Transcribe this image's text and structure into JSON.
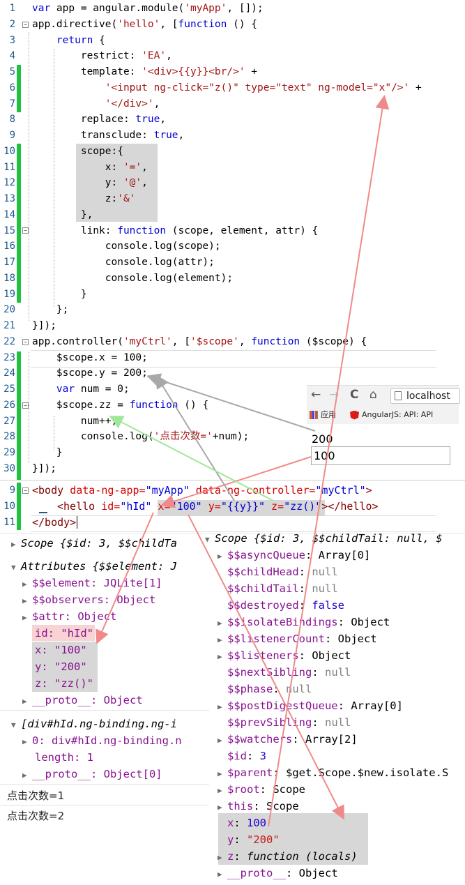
{
  "js_code": {
    "line_numbers": [
      "1",
      "2",
      "3",
      "4",
      "5",
      "6",
      "7",
      "8",
      "9",
      "10",
      "11",
      "12",
      "13",
      "14",
      "15",
      "16",
      "17",
      "18",
      "19",
      "20",
      "21",
      "22",
      "23",
      "24",
      "25",
      "26",
      "27",
      "28",
      "29",
      "30"
    ],
    "lines": [
      "var app = angular.module('myApp', []);",
      "app.directive('hello', [function () {",
      "    return {",
      "        restrict: 'EA',",
      "        template: '<div>{{y}}<br/>' +",
      "            '<input ng-click=\"z()\" type=\"text\" ng-model=\"x\"/>' +",
      "            '</div>',",
      "        replace: true,",
      "        transclude: true,",
      "        scope:{",
      "            x: '=',",
      "            y: '@',",
      "            z:'&'",
      "        },",
      "        link: function (scope, element, attr) {",
      "            console.log(scope);",
      "            console.log(attr);",
      "            console.log(element);",
      "        }",
      "    };",
      "}]);",
      "app.controller('myCtrl', ['$scope', function ($scope) {",
      "    $scope.x = 100;",
      "    $scope.y = 200;",
      "    var num = 0;",
      "    $scope.zz = function () {",
      "        num++;",
      "        console.log('点击次数='+num);",
      "    }",
      "}]);"
    ]
  },
  "html_code": {
    "line_numbers": [
      "9",
      "10",
      "11"
    ],
    "line9_parts": [
      "<body ",
      "data-ng-app=",
      "\"myApp\"",
      " data-ng-controller=",
      "\"myCtrl\"",
      ">"
    ],
    "line10_parts": [
      "<hello ",
      "id=",
      "\"hId\"",
      " x=",
      "\"100\"",
      " y=",
      "\"{{y}}\"",
      " z=",
      "\"zz()\"",
      "></hello>"
    ],
    "line11": "</body>"
  },
  "browser": {
    "back_icon": "←",
    "forward_icon": "→",
    "reload_icon": "C",
    "home_icon": "⌂",
    "url": "localhost",
    "bookmarks": [
      "应用",
      "AngularJS: API: API"
    ],
    "output_text": "200",
    "input_value": "100"
  },
  "console_left": {
    "scope_row": "Scope {$id: 3, $$childTa",
    "attributes_row": "Attributes {$$element: J",
    "element_row": "$$element: JQLite[1]",
    "observers_row": "$$observers: Object",
    "attr_row": "$attr: Object",
    "id_row": "id: \"hId\"",
    "x_row": "x: \"100\"",
    "y_row": "y: \"200\"",
    "z_row": "z: \"zz()\"",
    "proto_row": "__proto__: Object",
    "div_row": "[div#hId.ng-binding.ng-i",
    "zero_row": "0: div#hId.ng-binding.n",
    "length_row": "length: 1",
    "proto2_row": "__proto__: Object[0]",
    "clicks": [
      "点击次数=1",
      "点击次数=2"
    ]
  },
  "console_right": {
    "header": "Scope {$id: 3, $$childTail: null, $",
    "rows": [
      {
        "t": "▶",
        "k": "$$asyncQueue",
        "v": "Array[0]",
        "c": "obj"
      },
      {
        "t": "",
        "k": "$$childHead",
        "v": "null",
        "c": "nul"
      },
      {
        "t": "",
        "k": "$$childTail",
        "v": "null",
        "c": "nul"
      },
      {
        "t": "",
        "k": "$$destroyed",
        "v": "false",
        "c": "n"
      },
      {
        "t": "▶",
        "k": "$$isolateBindings",
        "v": "Object",
        "c": "obj"
      },
      {
        "t": "▶",
        "k": "$$listenerCount",
        "v": "Object",
        "c": "obj"
      },
      {
        "t": "▶",
        "k": "$$listeners",
        "v": "Object",
        "c": "obj"
      },
      {
        "t": "",
        "k": "$$nextSibling",
        "v": "null",
        "c": "nul"
      },
      {
        "t": "",
        "k": "$$phase",
        "v": "null",
        "c": "nul"
      },
      {
        "t": "▶",
        "k": "$$postDigestQueue",
        "v": "Array[0]",
        "c": "obj"
      },
      {
        "t": "",
        "k": "$$prevSibling",
        "v": "null",
        "c": "nul"
      },
      {
        "t": "▶",
        "k": "$$watchers",
        "v": "Array[2]",
        "c": "obj"
      },
      {
        "t": "",
        "k": "$id",
        "v": "3",
        "c": "n"
      },
      {
        "t": "▶",
        "k": "$parent",
        "v": "$get.Scope.$new.isolate.S",
        "c": "obj"
      },
      {
        "t": "▶",
        "k": "$root",
        "v": "Scope",
        "c": "obj"
      },
      {
        "t": "▶",
        "k": "this",
        "v": "Scope",
        "c": "obj"
      },
      {
        "t": "",
        "k": "x",
        "v": "100",
        "c": "n"
      },
      {
        "t": "",
        "k": "y",
        "v": "\"200\"",
        "c": "v"
      },
      {
        "t": "▶",
        "k": "z",
        "v": "function (locals)",
        "c": "fn"
      },
      {
        "t": "▶",
        "k": "__proto__",
        "v": "Object",
        "c": "obj"
      }
    ]
  },
  "colors": {
    "arrow_red": "#f08a8a",
    "arrow_gray": "#a8a8a8",
    "arrow_green": "#a8f0a0",
    "change_bar": "#1fc140"
  }
}
